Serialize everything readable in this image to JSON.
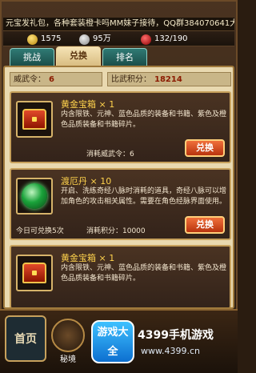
{
  "marquee": "元宝发礼包，各种套装橙卡吗MM妹子接待，QQ群384070641大神",
  "stats": {
    "ingot": "1575",
    "coin": "95万",
    "hp": "132/190"
  },
  "tabs": [
    {
      "label": "挑战"
    },
    {
      "label": "兑换"
    },
    {
      "label": "排名"
    }
  ],
  "info": {
    "weiwu_label": "威武令：",
    "weiwu_value": "6",
    "points_label": "比武积分：",
    "points_value": "18214"
  },
  "items": [
    {
      "title": "黄金宝箱 × 1",
      "desc": "内含限铁、元神、蓝色品质的装备和书籍、紫色及橙色品质装备和书籍碎片。",
      "cost": "消耗威武令：6",
      "limit": "",
      "button": "兑换",
      "icon": "chest-icon"
    },
    {
      "title": "渡厄丹 × 10",
      "desc": "开启、洗练奇经八脉时消耗的道具，奇经八脉可以增加角色的攻击相关属性。需要在角色经脉界面使用。",
      "cost": "消耗积分：10000",
      "limit": "今日可兑换5次",
      "button": "兑换",
      "icon": "orb-icon"
    },
    {
      "title": "黄金宝箱 × 1",
      "desc": "内含限铁、元神、蓝色品质的装备和书籍、紫色及橙色品质装备和书籍碎片。",
      "cost": "",
      "limit": "",
      "button": "",
      "icon": "chest-icon"
    }
  ],
  "bottom": {
    "home": "首页",
    "nav2": "秘境",
    "badge": "游戏大全",
    "brand": "4399手机游戏",
    "url": "www.4399.cn"
  }
}
